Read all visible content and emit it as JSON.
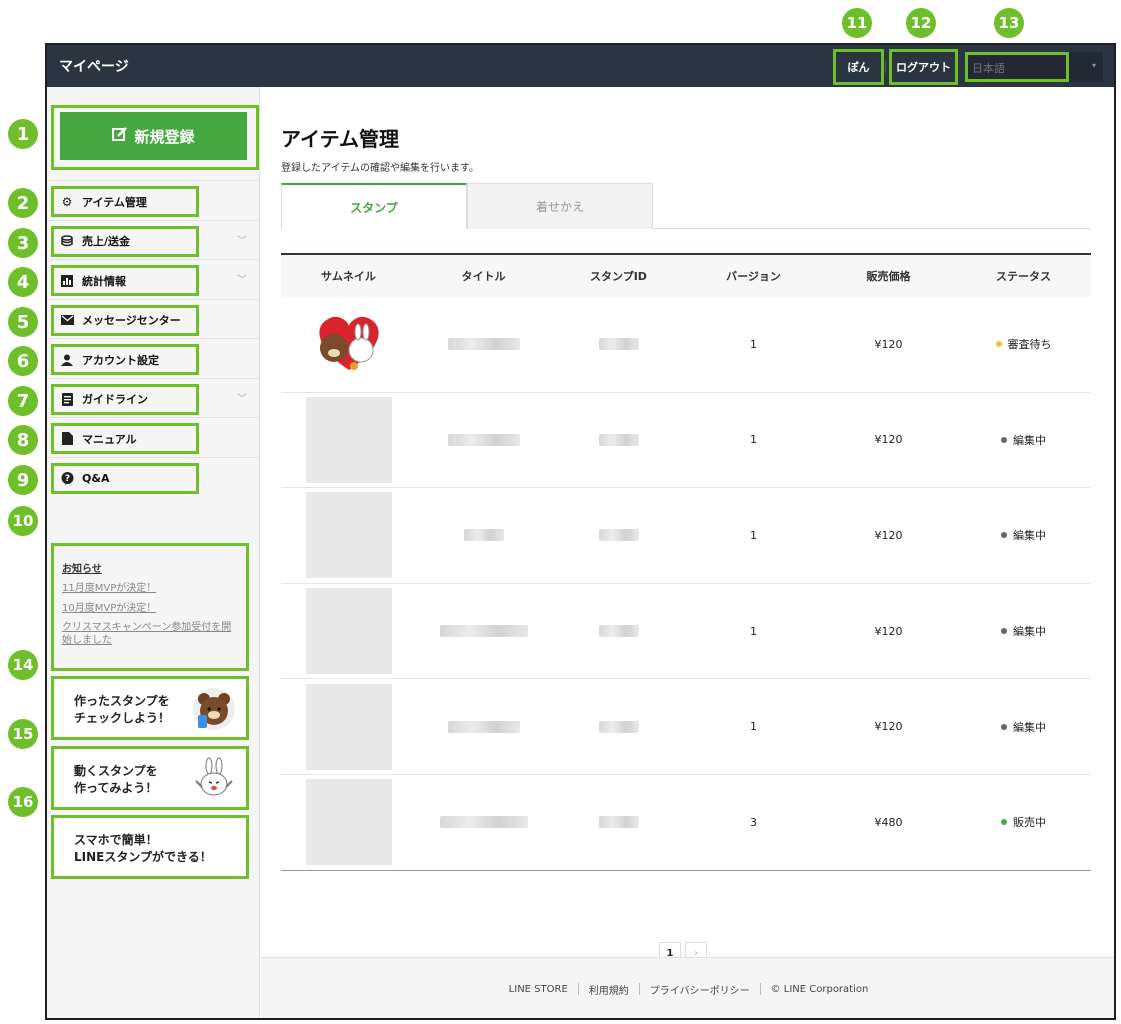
{
  "markers": [
    "1",
    "2",
    "3",
    "4",
    "5",
    "6",
    "7",
    "8",
    "9",
    "10",
    "11",
    "12",
    "13",
    "14",
    "15",
    "16"
  ],
  "header": {
    "title": "マイページ",
    "user": "ぽん",
    "logout": "ログアウト",
    "language": "日本語"
  },
  "sidebar": {
    "new_button": "新規登録",
    "items": [
      {
        "label": "アイテム管理",
        "icon": "gear-icon"
      },
      {
        "label": "売上/送金",
        "icon": "coins-icon"
      },
      {
        "label": "統計情報",
        "icon": "chart-icon"
      },
      {
        "label": "メッセージセンター",
        "icon": "envelope-icon"
      },
      {
        "label": "アカウント設定",
        "icon": "user-icon"
      },
      {
        "label": "ガイドライン",
        "icon": "document-icon"
      },
      {
        "label": "マニュアル",
        "icon": "file-icon"
      },
      {
        "label": "Q&A",
        "icon": "question-bubble-icon"
      }
    ],
    "news": {
      "title": "お知らせ",
      "links": [
        "11月度MVPが決定！",
        "10月度MVPが決定！",
        "クリスマスキャンペーン参加受付を開始しました"
      ]
    },
    "banners": [
      {
        "line1": "作ったスタンプを",
        "line2": "チェックしよう！"
      },
      {
        "line1": "動くスタンプを",
        "line2": "作ってみよう！"
      },
      {
        "line1": "スマホで簡単！",
        "line2": "LINEスタンプができる！"
      }
    ]
  },
  "main": {
    "title": "アイテム管理",
    "description": "登録したアイテムの確認や編集を行います。",
    "tabs": [
      "スタンプ",
      "着せかえ"
    ],
    "columns": [
      "サムネイル",
      "タイトル",
      "スタンプID",
      "バージョン",
      "販売価格",
      "ステータス"
    ],
    "rows": [
      {
        "version": "1",
        "price": "¥120",
        "status": "審査待ち",
        "status_color": "#f5c431"
      },
      {
        "version": "1",
        "price": "¥120",
        "status": "編集中",
        "status_color": "#666666"
      },
      {
        "version": "1",
        "price": "¥120",
        "status": "編集中",
        "status_color": "#666666"
      },
      {
        "version": "1",
        "price": "¥120",
        "status": "編集中",
        "status_color": "#666666"
      },
      {
        "version": "1",
        "price": "¥120",
        "status": "編集中",
        "status_color": "#666666"
      },
      {
        "version": "3",
        "price": "¥480",
        "status": "販売中",
        "status_color": "#45a840"
      }
    ],
    "pagination": {
      "current": "1",
      "next": "›"
    }
  },
  "footer": [
    "LINE STORE",
    "利用規約",
    "プライバシーポリシー",
    "© LINE Corporation"
  ],
  "colors": {
    "accent": "#45a840",
    "highlight": "#6fbf2a",
    "topbar": "#2b3441"
  }
}
